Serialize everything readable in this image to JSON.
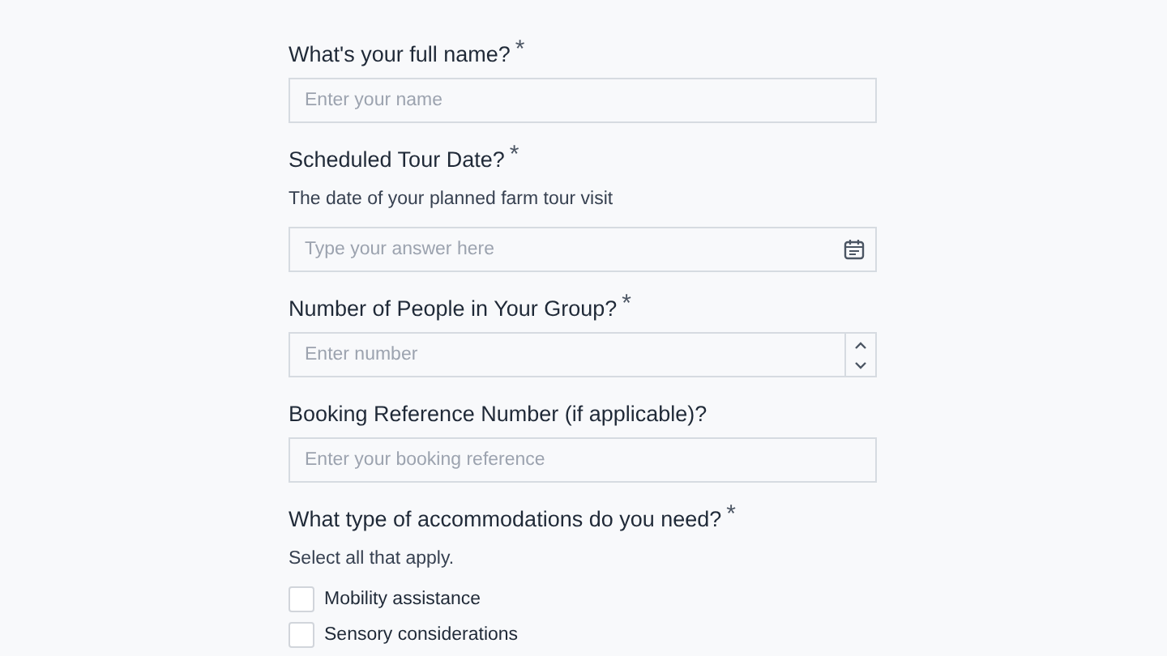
{
  "required_mark": "*",
  "questions": [
    {
      "kind": "text",
      "label": "What's your full name?",
      "required": true,
      "placeholder": "Enter your name"
    },
    {
      "kind": "date",
      "label": "Scheduled Tour Date?",
      "required": true,
      "description": "The date of your planned farm tour visit",
      "placeholder": "Type your answer here"
    },
    {
      "kind": "number",
      "label": "Number of People in Your Group?",
      "required": true,
      "placeholder": "Enter number"
    },
    {
      "kind": "text",
      "label": "Booking Reference Number (if applicable)?",
      "required": false,
      "placeholder": "Enter your booking reference"
    },
    {
      "kind": "checkboxes",
      "label": "What type of accommodations do you need?",
      "required": true,
      "description": "Select all that apply.",
      "options": [
        {
          "label": "Mobility assistance",
          "checked": false
        },
        {
          "label": "Sensory considerations",
          "checked": false
        }
      ]
    }
  ]
}
